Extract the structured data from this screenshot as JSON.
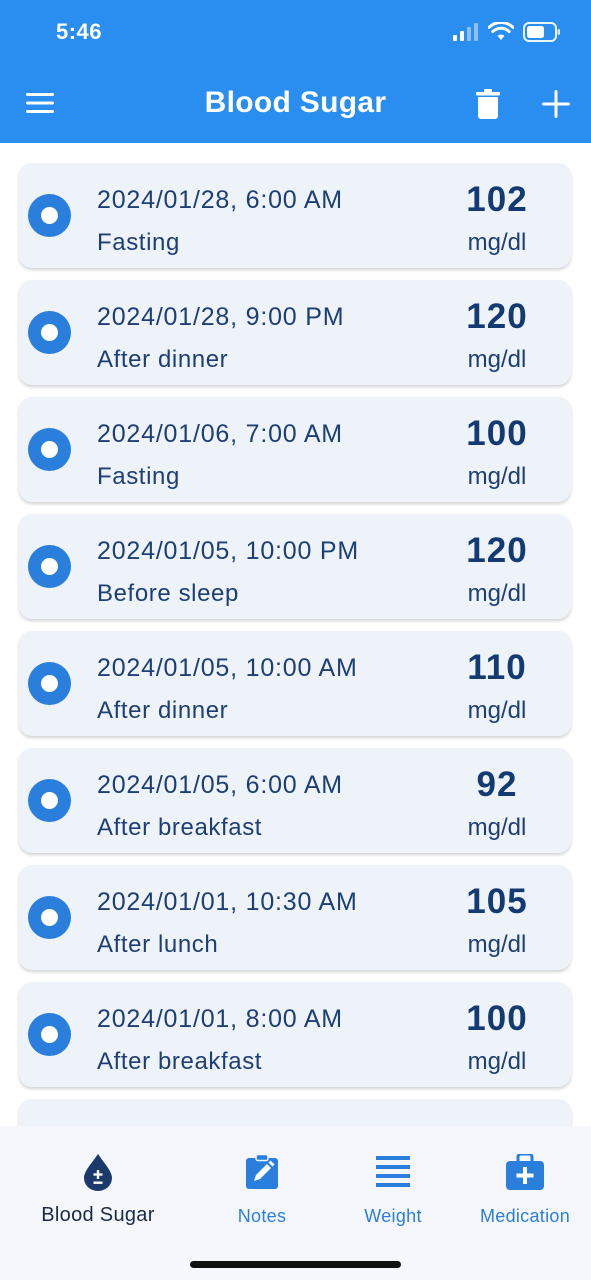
{
  "status_bar": {
    "time": "5:46"
  },
  "header": {
    "title": "Blood Sugar"
  },
  "readings": [
    {
      "datetime": "2024/01/28, 6:00 AM",
      "context": "Fasting",
      "value": "102",
      "unit": "mg/dl"
    },
    {
      "datetime": "2024/01/28, 9:00 PM",
      "context": "After dinner",
      "value": "120",
      "unit": "mg/dl"
    },
    {
      "datetime": "2024/01/06, 7:00 AM",
      "context": "Fasting",
      "value": "100",
      "unit": "mg/dl"
    },
    {
      "datetime": "2024/01/05, 10:00 PM",
      "context": "Before sleep",
      "value": "120",
      "unit": "mg/dl"
    },
    {
      "datetime": "2024/01/05, 10:00 AM",
      "context": "After dinner",
      "value": "110",
      "unit": "mg/dl"
    },
    {
      "datetime": "2024/01/05, 6:00 AM",
      "context": "After breakfast",
      "value": "92",
      "unit": "mg/dl"
    },
    {
      "datetime": "2024/01/01, 10:30 AM",
      "context": "After lunch",
      "value": "105",
      "unit": "mg/dl"
    },
    {
      "datetime": "2024/01/01, 8:00 AM",
      "context": "After breakfast",
      "value": "100",
      "unit": "mg/dl"
    }
  ],
  "tabs": [
    {
      "label": "Blood Sugar",
      "icon": "blood-drop-icon",
      "active": true
    },
    {
      "label": "Notes",
      "icon": "edit-note-icon",
      "active": false
    },
    {
      "label": "Weight",
      "icon": "lines-icon",
      "active": false
    },
    {
      "label": "Medication",
      "icon": "medical-kit-icon",
      "active": false
    }
  ],
  "colors": {
    "header": "#2a8df0",
    "accent": "#2a7fdc",
    "card": "#eef2f9",
    "text": "#1d3f74",
    "tab_bar": "#f5f7fc"
  }
}
